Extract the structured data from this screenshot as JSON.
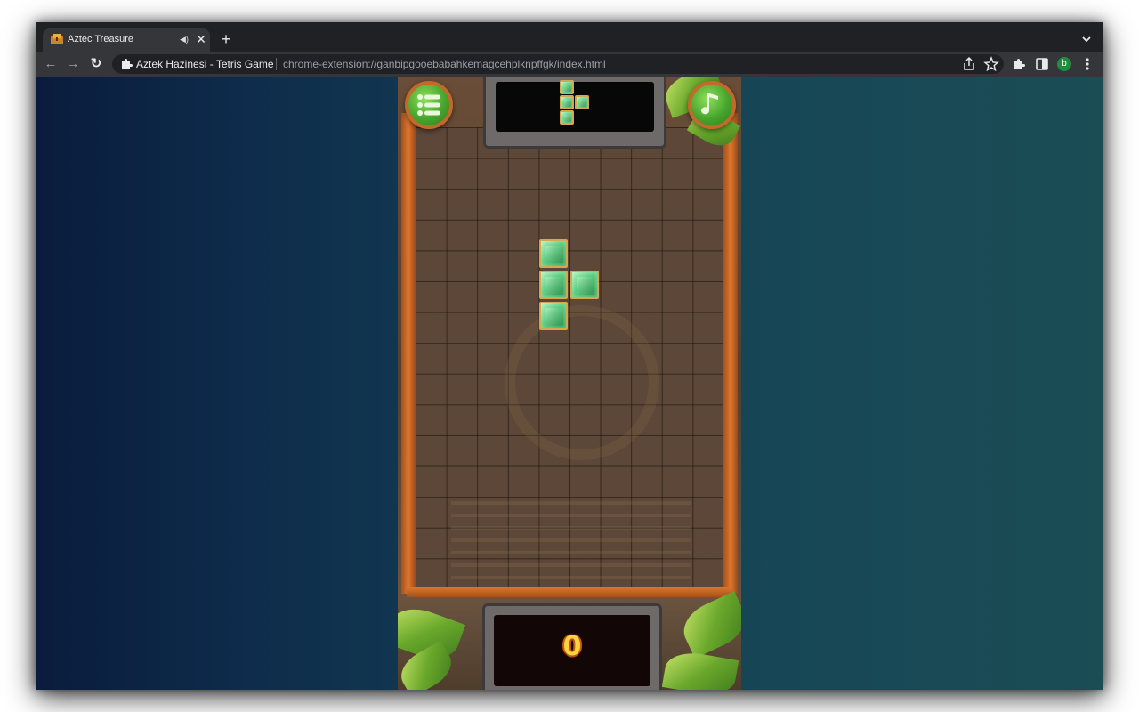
{
  "browser": {
    "tab": {
      "title": "Aztec Treasure",
      "favicon": "aztec-treasure-favicon",
      "audio_icon": "speaker-icon",
      "close_icon": "close-icon"
    },
    "new_tab_icon": "plus-icon",
    "tab_search_icon": "chevron-down-icon",
    "nav": {
      "back_icon": "arrow-left-icon",
      "forward_icon": "arrow-right-icon",
      "reload_icon": "reload-icon"
    },
    "omnibox": {
      "extension_name": "Aztek Hazinesi - Tetris Game",
      "url": "chrome-extension://ganbipgooebabahkemagcehplknpffgk/index.html"
    },
    "toolbar_icons": [
      "share-icon",
      "star-icon",
      "extensions-puzzle-icon",
      "side-panel-icon",
      "kebab-menu-icon"
    ],
    "profile_initial": "b",
    "profile_color": "#1e8e3e"
  },
  "game": {
    "menu_button_icon": "list-menu-icon",
    "music_button_icon": "music-note-icon",
    "score": "0",
    "board": {
      "columns": 10,
      "rows": 15
    },
    "block_color": "#4fcf78",
    "block_border_color": "#d2a850",
    "active_piece": {
      "shape": "T",
      "cells": [
        [
          4,
          4
        ],
        [
          4,
          5
        ],
        [
          5,
          5
        ],
        [
          4,
          6
        ]
      ]
    },
    "next_piece": {
      "shape": "T",
      "cells": [
        [
          0,
          0
        ],
        [
          0,
          1
        ],
        [
          1,
          1
        ],
        [
          0,
          2
        ]
      ]
    }
  }
}
